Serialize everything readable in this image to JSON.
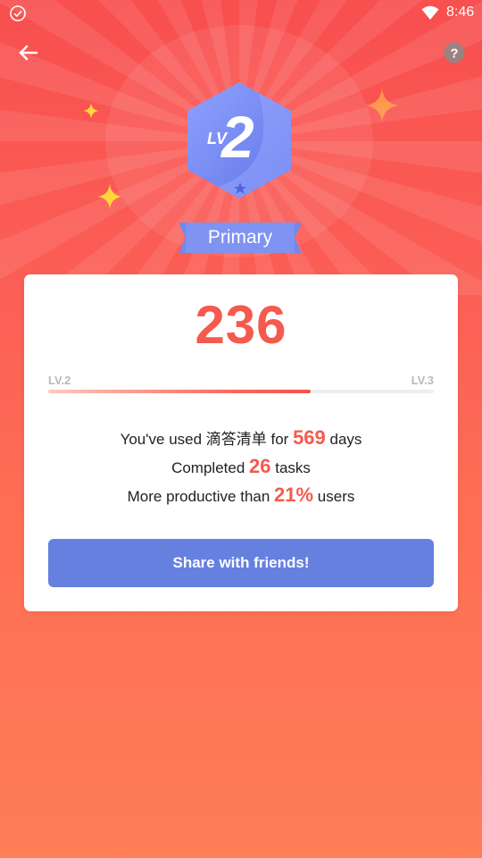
{
  "status_bar": {
    "time": "8:46"
  },
  "level": {
    "badge_prefix": "LV",
    "badge_number": "2",
    "name": "Primary",
    "current_label": "LV.2",
    "next_label": "LV.3",
    "progress_fraction": 0.68
  },
  "card": {
    "score": "236",
    "stats": [
      {
        "before": "You've used 滴答清单 for ",
        "value": "569",
        "after": " days"
      },
      {
        "before": "Completed ",
        "value": "26",
        "after": " tasks"
      },
      {
        "before": "More productive than ",
        "value": "21%",
        "after": " users"
      }
    ],
    "share_label": "Share with friends!"
  },
  "colors": {
    "accent_red": "#f55a4e",
    "badge_blue": "#7b8ef0",
    "button_blue": "#6680e0",
    "sparkle_yellow": "#ffd63a"
  },
  "icons": {
    "status_left": "check-circle-icon",
    "wifi": "wifi-icon",
    "back": "arrow-left-icon",
    "help": "question-circle-icon"
  }
}
